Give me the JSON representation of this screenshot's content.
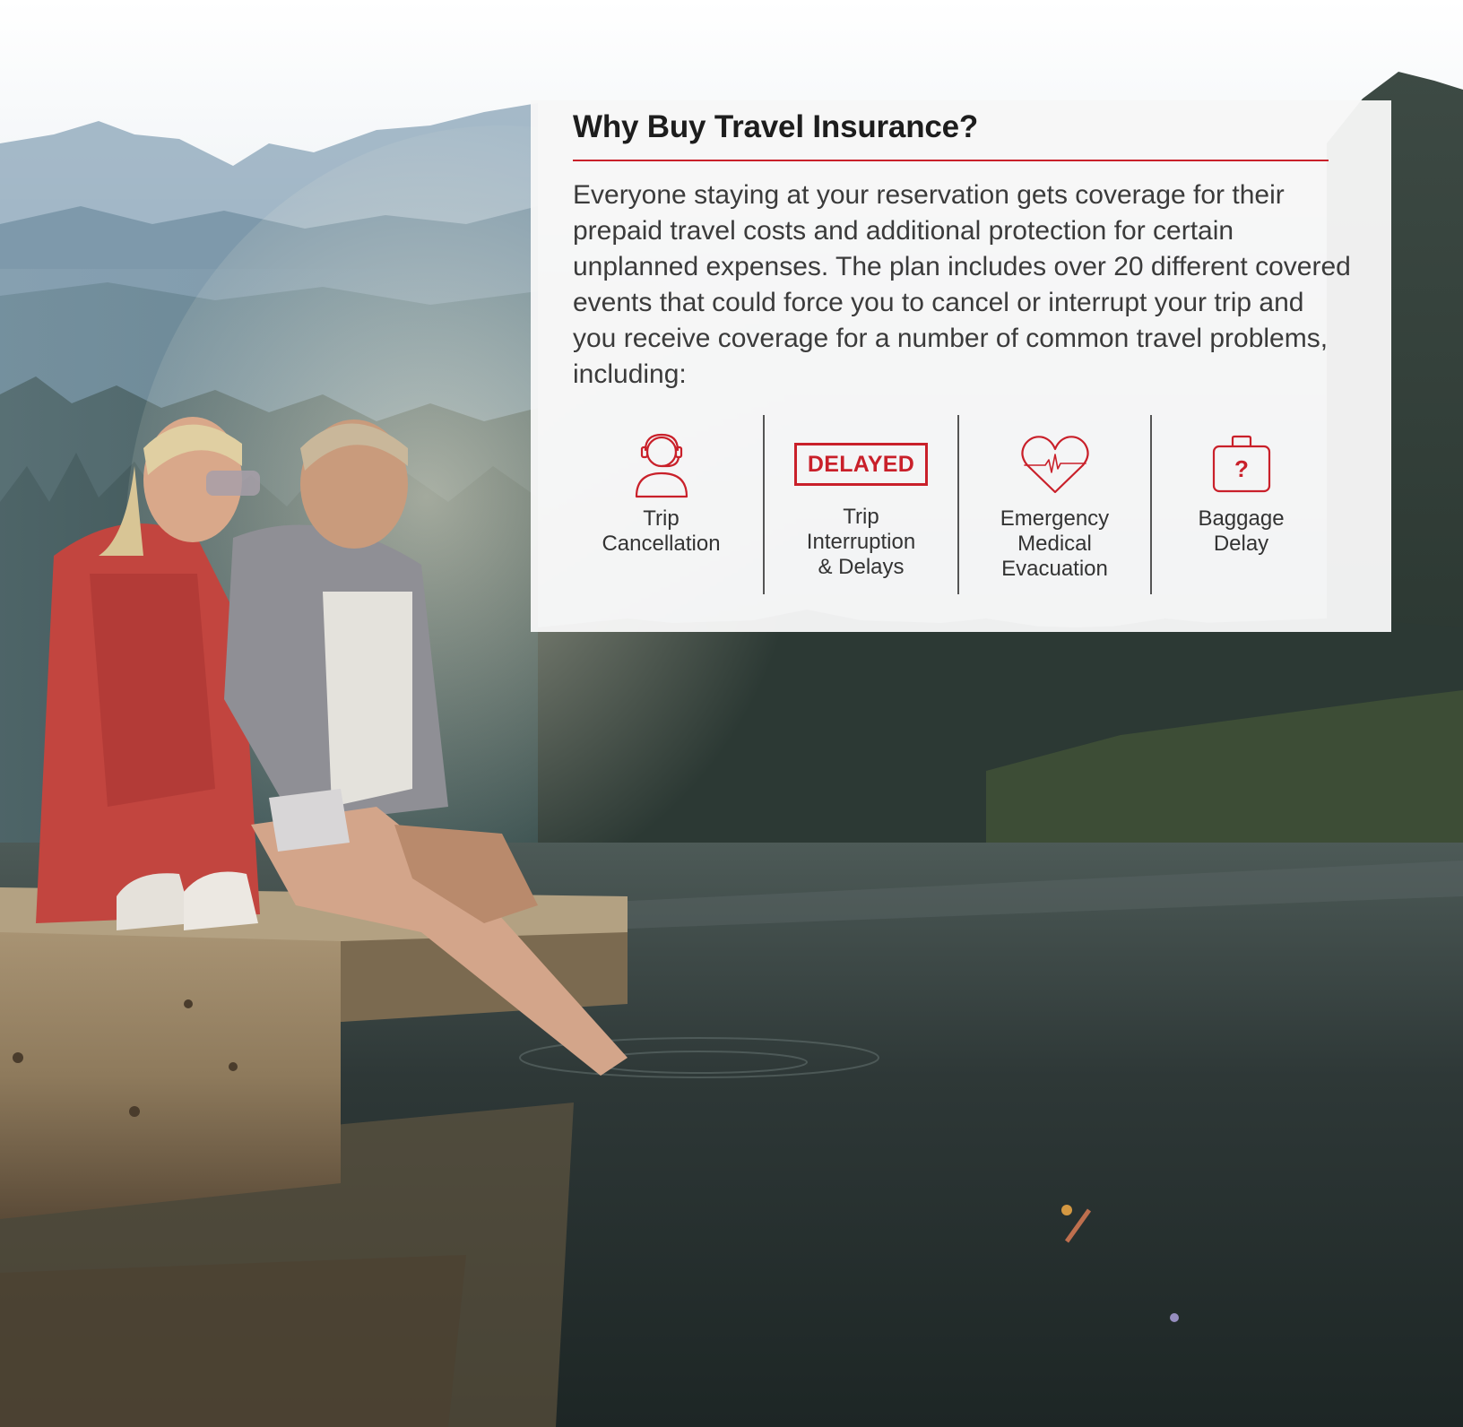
{
  "card": {
    "title": "Why Buy Travel Insurance?",
    "body": "Everyone staying at your reservation gets coverage for their prepaid travel costs and additional protection for certain unplanned expenses. The plan includes over 20 different covered events that could force you to cancel or interrupt your trip and you receive coverage for a number of common travel problems, including:"
  },
  "features": [
    {
      "icon": "headset-person-icon",
      "label": "Trip\nCancellation"
    },
    {
      "icon": "delayed-badge-icon",
      "badge_text": "DELAYED",
      "label": "Trip\nInterruption\n& Delays"
    },
    {
      "icon": "heart-pulse-icon",
      "label": "Emergency\nMedical\nEvacuation"
    },
    {
      "icon": "suitcase-question-icon",
      "icon_text": "?",
      "label": "Baggage\nDelay"
    }
  ],
  "colors": {
    "accent": "#c9202a",
    "card_background": "#f7f7f7",
    "text": "#3b3b3b"
  }
}
